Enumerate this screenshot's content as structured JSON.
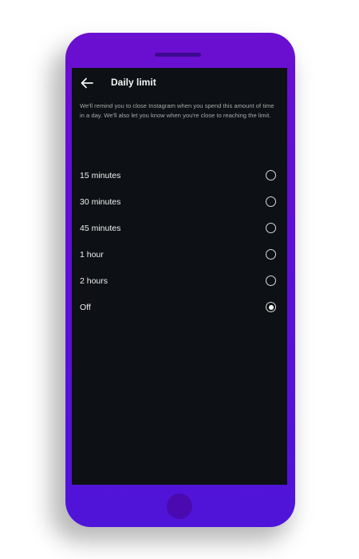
{
  "header": {
    "back_icon": "arrow-left-icon",
    "title": "Daily limit"
  },
  "description": "We'll remind you to close Instagram when you spend this amount of time in a day. We'll also let you know when you're close to reaching the limit.",
  "options": [
    {
      "label": "15 minutes",
      "selected": false
    },
    {
      "label": "30 minutes",
      "selected": false
    },
    {
      "label": "45 minutes",
      "selected": false
    },
    {
      "label": "1 hour",
      "selected": false
    },
    {
      "label": "2 hours",
      "selected": false
    },
    {
      "label": "Off",
      "selected": true
    }
  ],
  "colors": {
    "phone_frame": "#5a10d6",
    "screen_background": "#0d1014",
    "text_primary": "#f5f5f5",
    "text_secondary": "#a8a8a8"
  }
}
